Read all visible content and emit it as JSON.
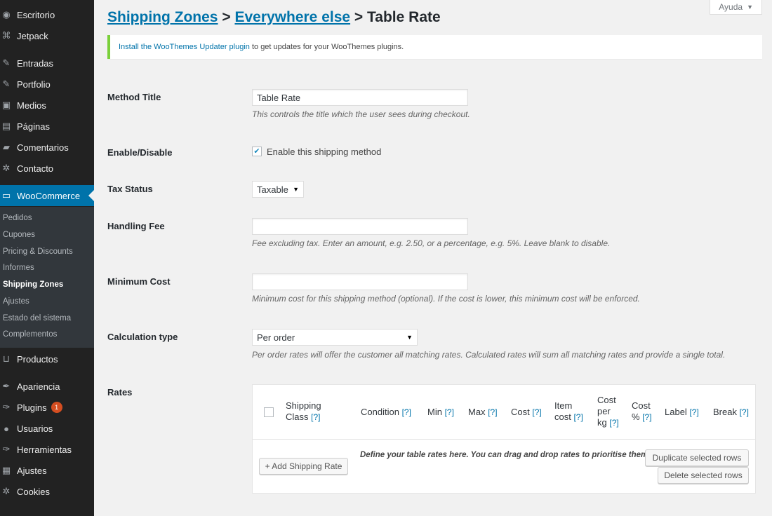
{
  "sidebar": {
    "items": [
      {
        "label": "Escritorio",
        "icon": "dashboard-icon",
        "glyph": "◉"
      },
      {
        "label": "Jetpack",
        "icon": "jetpack-icon",
        "glyph": "⌘"
      },
      {
        "label": "Entradas",
        "icon": "pin-icon",
        "glyph": "✎"
      },
      {
        "label": "Portfolio",
        "icon": "pin-icon",
        "glyph": "✎"
      },
      {
        "label": "Medios",
        "icon": "media-icon",
        "glyph": "▣"
      },
      {
        "label": "Páginas",
        "icon": "pages-icon",
        "glyph": "▤"
      },
      {
        "label": "Comentarios",
        "icon": "comments-icon",
        "glyph": "▰"
      },
      {
        "label": "Contacto",
        "icon": "gear-icon",
        "glyph": "✲"
      },
      {
        "label": "WooCommerce",
        "icon": "woocommerce-icon",
        "glyph": "▭"
      },
      {
        "label": "Productos",
        "icon": "cart-icon",
        "glyph": "⊔"
      },
      {
        "label": "Apariencia",
        "icon": "brush-icon",
        "glyph": "✒"
      },
      {
        "label": "Plugins",
        "icon": "plugin-icon",
        "glyph": "✑",
        "badge": "1"
      },
      {
        "label": "Usuarios",
        "icon": "users-icon",
        "glyph": "●"
      },
      {
        "label": "Herramientas",
        "icon": "wrench-icon",
        "glyph": "✑"
      },
      {
        "label": "Ajustes",
        "icon": "settings-icon",
        "glyph": "▦"
      },
      {
        "label": "Cookies",
        "icon": "gear-icon",
        "glyph": "✲"
      }
    ],
    "submenu": [
      "Pedidos",
      "Cupones",
      "Pricing & Discounts",
      "Informes",
      "Shipping Zones",
      "Ajustes",
      "Estado del sistema",
      "Complementos"
    ]
  },
  "header": {
    "help_label": "Ayuda",
    "breadcrumb": {
      "crumb1": "Shipping Zones",
      "sep": ">",
      "crumb2": "Everywhere else",
      "current": "Table Rate"
    }
  },
  "notice": {
    "link": "Install the WooThemes Updater plugin",
    "text": " to get updates for your WooThemes plugins."
  },
  "form": {
    "method_title": {
      "label": "Method Title",
      "value": "Table Rate",
      "desc": "This controls the title which the user sees during checkout."
    },
    "enable": {
      "label": "Enable/Disable",
      "checkbox_label": "Enable this shipping method",
      "checked": true
    },
    "tax_status": {
      "label": "Tax Status",
      "value": "Taxable"
    },
    "handling_fee": {
      "label": "Handling Fee",
      "value": "",
      "desc": "Fee excluding tax. Enter an amount, e.g. 2.50, or a percentage, e.g. 5%. Leave blank to disable."
    },
    "minimum_cost": {
      "label": "Minimum Cost",
      "value": "",
      "desc": "Minimum cost for this shipping method (optional). If the cost is lower, this minimum cost will be enforced."
    },
    "calculation_type": {
      "label": "Calculation type",
      "value": "Per order",
      "desc": "Per order rates will offer the customer all matching rates. Calculated rates will sum all matching rates and provide a single total."
    },
    "rates": {
      "label": "Rates",
      "help": "[?]",
      "columns": {
        "shipping_class_1": "Shipping",
        "shipping_class_2": "Class",
        "condition": "Condition",
        "min": "Min",
        "max": "Max",
        "cost": "Cost",
        "item_cost_1": "Item",
        "item_cost_2": "cost",
        "cost_per_kg_1": "Cost",
        "cost_per_kg_2": "per",
        "cost_per_kg_3": "kg",
        "cost_pct_1": "Cost",
        "cost_pct_2": "%",
        "label": "Label",
        "break": "Break"
      },
      "add_button": "+ Add Shipping Rate",
      "footer_text": "Define your table rates here. You can drag and drop rates to prioritise them.",
      "duplicate_button": "Duplicate selected rows",
      "delete_button": "Delete selected rows"
    }
  },
  "colors": {
    "sidebar_bg": "#222222",
    "submenu_bg": "#32373c",
    "accent": "#0073aa",
    "notice_border": "#7ad03a",
    "badge": "#d54e21"
  }
}
